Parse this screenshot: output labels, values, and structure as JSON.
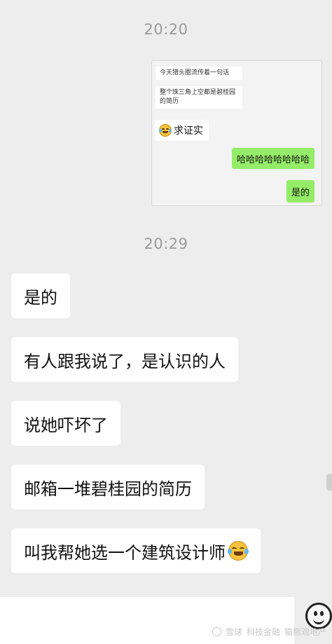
{
  "timestamps": {
    "first": "20:20",
    "second": "20:29"
  },
  "screenshot_card": {
    "quote_1": "今天猎头圈流传着一句话",
    "quote_2": "整个珠三角上空都是碧桂园的简历",
    "left_message": "求证实",
    "right_message_1": "哈哈哈哈哈哈哈哈",
    "right_message_2": "是的"
  },
  "messages": [
    {
      "text": "是的"
    },
    {
      "text": "有人跟我说了，是认识的人"
    },
    {
      "text": "说她吓坏了"
    },
    {
      "text": "邮箱一堆碧桂园的简历"
    },
    {
      "text": "叫我帮她选一个建筑设计师"
    }
  ],
  "icons": {
    "emoji": "laughing-crying-emoji-icon",
    "input_emoji": "smiley-face-icon"
  },
  "watermark": {
    "site": "雪球",
    "author": "猫熊观地产",
    "secondary": "科技金融"
  },
  "colors": {
    "background": "#ededed",
    "incoming_bubble": "#ffffff",
    "outgoing_bubble": "#95ec69",
    "timestamp": "#9b9b9b"
  }
}
